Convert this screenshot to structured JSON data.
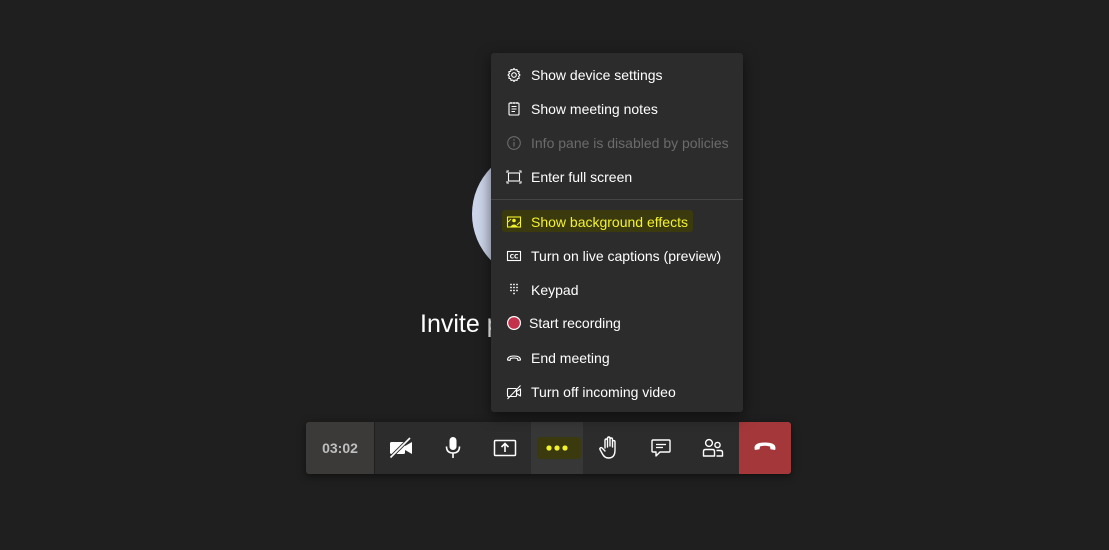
{
  "stage": {
    "invite_text": "Invite p"
  },
  "menu": {
    "items": [
      {
        "label": "Show device settings",
        "icon": "gear-icon",
        "enabled": true
      },
      {
        "label": "Show meeting notes",
        "icon": "notes-icon",
        "enabled": true
      },
      {
        "label": "Info pane is disabled by policies",
        "icon": "info-icon",
        "enabled": false
      },
      {
        "label": "Enter full screen",
        "icon": "fullscreen-icon",
        "enabled": true
      },
      {
        "label": "Show background effects",
        "icon": "background-effects-icon",
        "enabled": true,
        "highlighted": true
      },
      {
        "label": "Turn on live captions (preview)",
        "icon": "captions-icon",
        "enabled": true
      },
      {
        "label": "Keypad",
        "icon": "keypad-icon",
        "enabled": true
      },
      {
        "label": "Start recording",
        "icon": "record-icon",
        "enabled": true
      },
      {
        "label": "End meeting",
        "icon": "end-meeting-icon",
        "enabled": true
      },
      {
        "label": "Turn off incoming video",
        "icon": "video-off-icon",
        "enabled": true
      }
    ]
  },
  "toolbar": {
    "timer": "03:02",
    "buttons": [
      {
        "name": "camera-off-button",
        "icon": "camera-off-icon"
      },
      {
        "name": "microphone-button",
        "icon": "microphone-icon"
      },
      {
        "name": "share-button",
        "icon": "share-icon"
      },
      {
        "name": "more-actions-button",
        "icon": "more-icon",
        "active": true
      },
      {
        "name": "raise-hand-button",
        "icon": "hand-icon"
      },
      {
        "name": "chat-button",
        "icon": "chat-icon"
      },
      {
        "name": "participants-button",
        "icon": "participants-icon"
      },
      {
        "name": "hang-up-button",
        "icon": "hang-up-icon"
      }
    ]
  },
  "colors": {
    "background": "#1f1f1f",
    "menu_bg": "#2d2c2c",
    "highlight_text": "#f4f32b",
    "highlight_bg": "#3a3a0e",
    "hangup_bg": "#a4373a",
    "record_dot": "#c4314b",
    "disabled_text": "#6b6b6b"
  }
}
